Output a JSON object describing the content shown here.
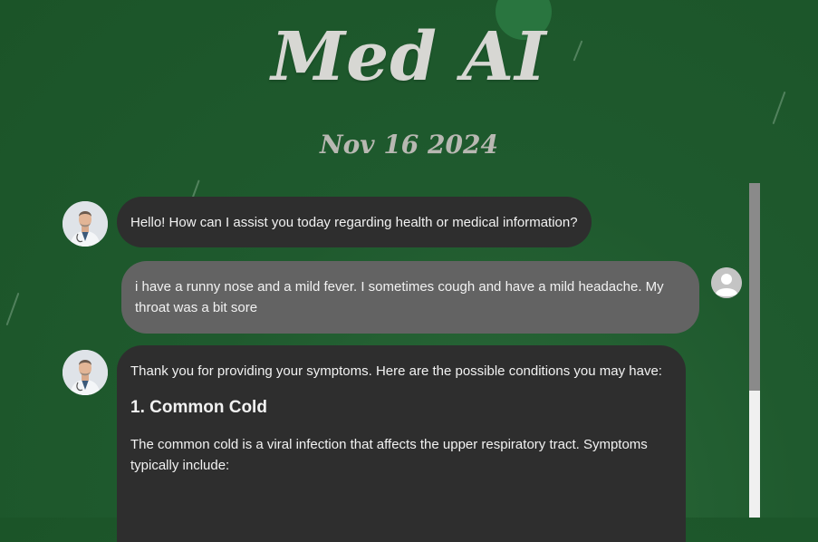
{
  "app": {
    "title": "Med AI",
    "date": "Nov 16 2024"
  },
  "colors": {
    "background": "#1f5a2e",
    "bot_bubble": "#2e2e2e",
    "user_bubble": "#636363",
    "title_text": "#d7d7d3"
  },
  "messages": [
    {
      "sender": "bot",
      "avatar": "doctor-avatar",
      "text": "Hello! How can I assist you today regarding health or medical information?"
    },
    {
      "sender": "user",
      "avatar": "user-avatar-icon",
      "text": "i have a runny nose and a mild fever. I sometimes cough and have a mild headache. My throat was a bit sore"
    },
    {
      "sender": "bot",
      "avatar": "doctor-avatar",
      "intro": "Thank you for providing your symptoms. Here are the possible conditions you may have:",
      "heading": "1. Common Cold",
      "body": "The common cold is a viral infection that affects the upper respiratory tract. Symptoms typically include:"
    }
  ],
  "scrollbar": {
    "scroll_fraction_visible": 0.62
  }
}
